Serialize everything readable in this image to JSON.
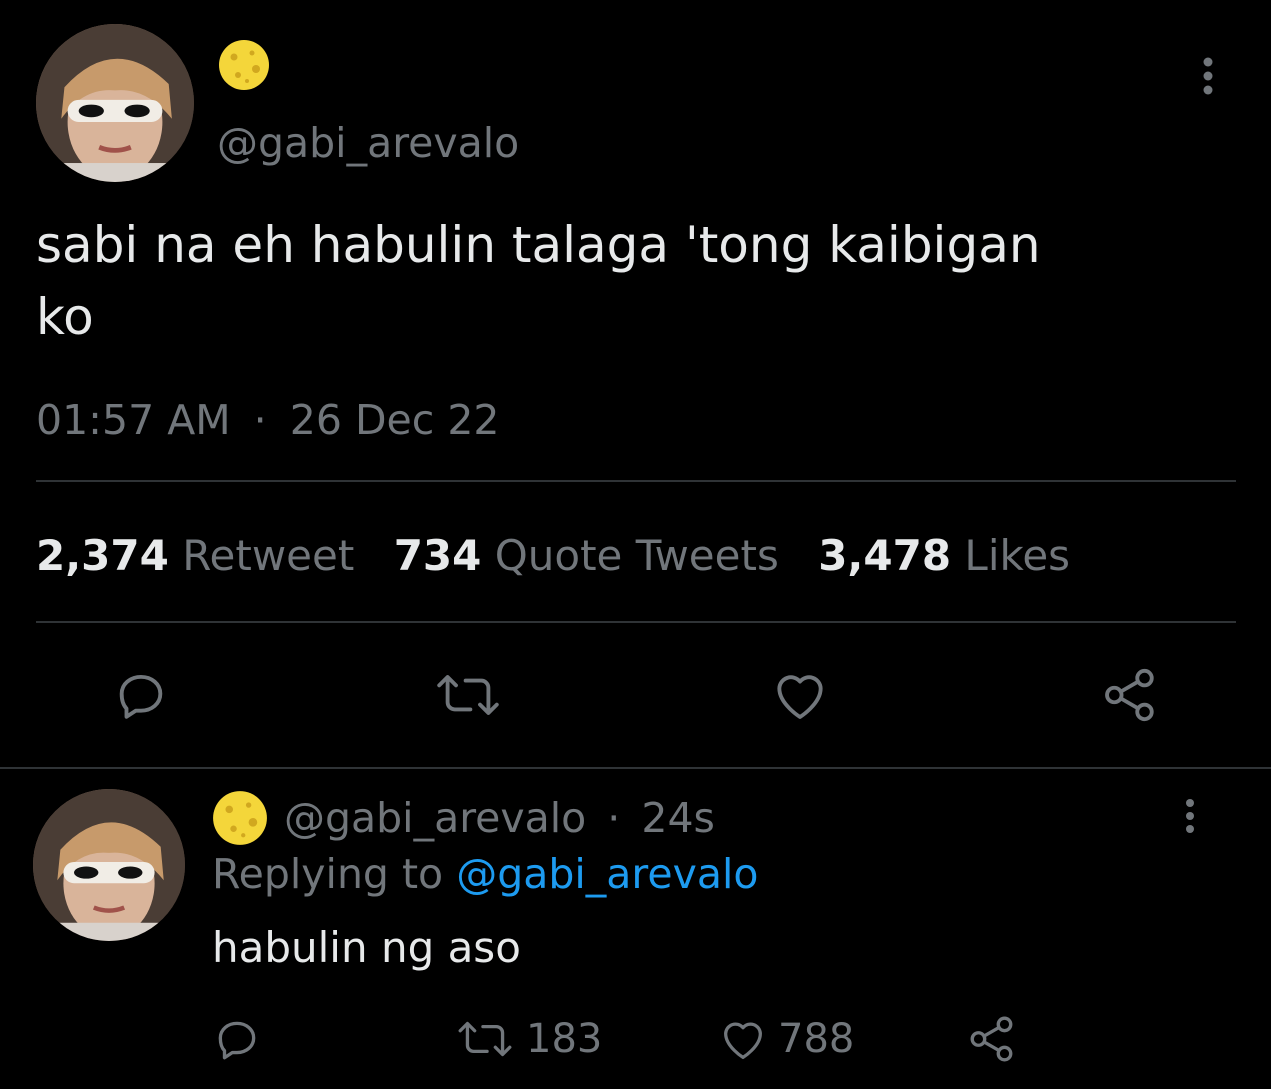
{
  "main_tweet": {
    "handle": "@gabi_arevalo",
    "text_line1": "sabi na eh habulin talaga 'tong kaibigan",
    "text_line2": "ko",
    "time": "01:57 AM",
    "separator": "·",
    "date": "26 Dec 22",
    "stats": {
      "retweets_count": "2,374",
      "retweets_label": "Retweet",
      "quotes_count": "734",
      "quotes_label": "Quote Tweets",
      "likes_count": "3,478",
      "likes_label": "Likes"
    }
  },
  "reply": {
    "handle": "@gabi_arevalo",
    "separator": "·",
    "age": "24s",
    "replying_prefix": "Replying to",
    "replying_to": "@gabi_arevalo",
    "text": "habulin ng aso",
    "retweet_count": "183",
    "like_count": "788"
  },
  "icons": {
    "emoji": "full-moon-face-emoji",
    "more": "more-vertical-icon",
    "reply": "reply-icon",
    "retweet": "retweet-icon",
    "like": "heart-icon",
    "share": "share-icon"
  },
  "colors": {
    "background": "#000000",
    "text": "#e7e9ea",
    "muted": "#71767b",
    "link": "#1d9bf0",
    "divider": "#2f3336",
    "emoji": "#f4d63a"
  }
}
